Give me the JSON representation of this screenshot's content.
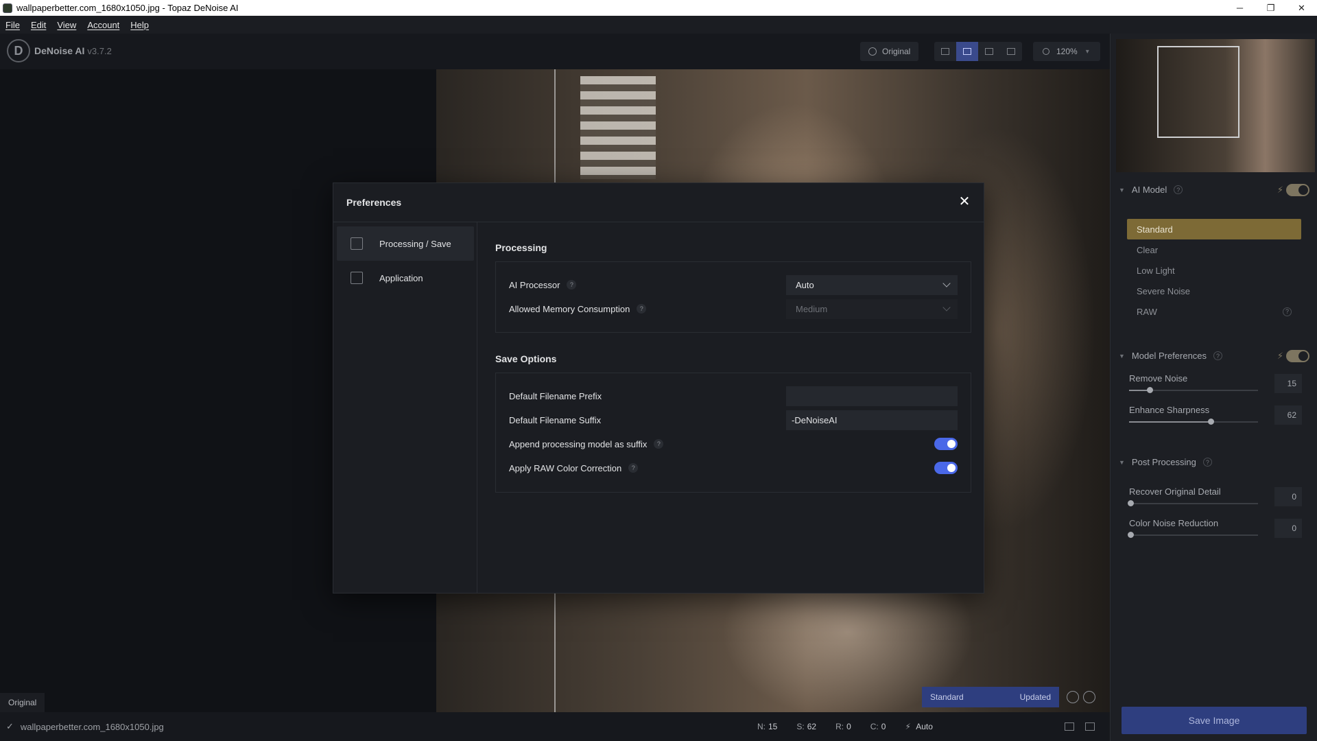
{
  "window": {
    "title": "wallpaperbetter.com_1680x1050.jpg - Topaz DeNoise AI",
    "minimize": "─",
    "restore": "❐",
    "close": "✕"
  },
  "menu": [
    "File",
    "Edit",
    "View",
    "Account",
    "Help"
  ],
  "brand": {
    "logo_letter": "D",
    "name": "DeNoise AI",
    "version": "v3.7.2"
  },
  "toolbar": {
    "original_label": "Original",
    "zoom_level": "120%"
  },
  "canvas": {
    "original_tag": "Original",
    "pill_model": "Standard",
    "pill_state": "Updated"
  },
  "statusbar": {
    "check": "✓",
    "filename": "wallpaperbetter.com_1680x1050.jpg",
    "n_label": "N:",
    "n_value": "15",
    "s_label": "S:",
    "s_value": "62",
    "r_label": "R:",
    "r_value": "0",
    "c_label": "C:",
    "c_value": "0",
    "bolt": "⚡",
    "processor": "Auto"
  },
  "right_panel": {
    "ai_model": {
      "title": "AI Model",
      "help": "?",
      "models": [
        "Standard",
        "Clear",
        "Low Light",
        "Severe Noise",
        "RAW"
      ],
      "selected": "Standard"
    },
    "model_prefs": {
      "title": "Model Preferences",
      "help": "?",
      "sliders": [
        {
          "label": "Remove Noise",
          "value": "15",
          "fraction": 0.15
        },
        {
          "label": "Enhance Sharpness",
          "value": "62",
          "fraction": 0.62
        }
      ]
    },
    "post_processing": {
      "title": "Post Processing",
      "help": "?",
      "sliders": [
        {
          "label": "Recover Original Detail",
          "value": "0",
          "fraction": 0
        },
        {
          "label": "Color Noise Reduction",
          "value": "0",
          "fraction": 0
        }
      ]
    },
    "save_label": "Save Image"
  },
  "preferences": {
    "title": "Preferences",
    "close": "✕",
    "nav": [
      {
        "label": "Processing / Save",
        "active": true
      },
      {
        "label": "Application",
        "active": false
      }
    ],
    "processing": {
      "title": "Processing",
      "ai_processor_label": "AI Processor",
      "ai_processor_value": "Auto",
      "memory_label": "Allowed Memory Consumption",
      "memory_value": "Medium",
      "help": "?"
    },
    "save_options": {
      "title": "Save Options",
      "prefix_label": "Default Filename Prefix",
      "prefix_value": "",
      "suffix_label": "Default Filename Suffix",
      "suffix_value": "-DeNoiseAI",
      "append_label": "Append processing model as suffix",
      "append_on": true,
      "raw_label": "Apply RAW Color Correction",
      "raw_on": true,
      "help": "?"
    }
  }
}
